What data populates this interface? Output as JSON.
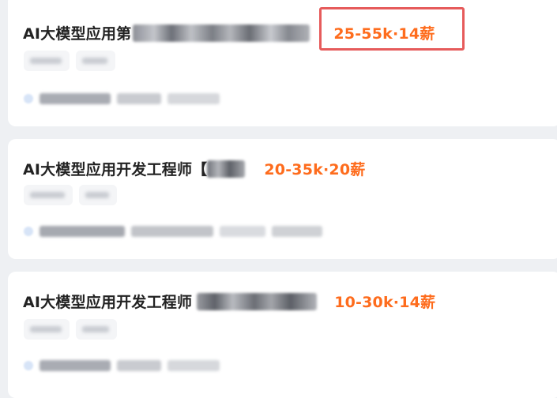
{
  "jobs": [
    {
      "title": "AI大模型应用第",
      "salary": "25-55k·14薪",
      "highlighted": true
    },
    {
      "title": "AI大模型应用开发工程师【",
      "salary": "20-35k·20薪",
      "highlighted": false
    },
    {
      "title": "AI大模型应用开发工程师",
      "salary": "10-30k·14薪",
      "highlighted": false
    }
  ],
  "colors": {
    "salary": "#fe6c1d",
    "highlight_border": "#e65b5b",
    "title": "#222222",
    "card_background": "#ffffff",
    "page_background": "#eef0f3"
  }
}
